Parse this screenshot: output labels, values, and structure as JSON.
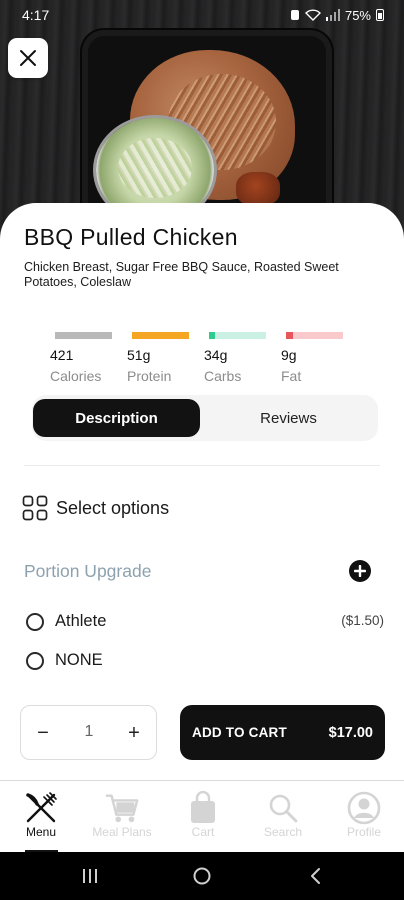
{
  "status_bar": {
    "time": "4:17",
    "battery": "75%"
  },
  "product": {
    "title": "BBQ Pulled Chicken",
    "ingredients": "Chicken Breast, Sugar Free BBQ Sauce, Roasted Sweet Potatoes, Coleslaw"
  },
  "macros": [
    {
      "value": "421",
      "label": "Calories",
      "color": "#b9b9b9",
      "track": "#b9b9b9",
      "fill_fraction": 1.0
    },
    {
      "value": "51g",
      "label": "Protein",
      "color": "#f5a623",
      "track": "#f5a623",
      "fill_fraction": 1.0
    },
    {
      "value": "34g",
      "label": "Carbs",
      "color": "#2ecc8f",
      "track": "#c9f0e2",
      "fill_fraction": 0.1
    },
    {
      "value": "9g",
      "label": "Fat",
      "color": "#e8565b",
      "track": "#f9c9cb",
      "fill_fraction": 0.12
    }
  ],
  "tabs": {
    "description": "Description",
    "reviews": "Reviews",
    "active": "Description"
  },
  "select_options": {
    "label": "Select options"
  },
  "portion": {
    "title": "Portion Upgrade",
    "options": [
      {
        "label": "Athlete",
        "price": "($1.50)"
      },
      {
        "label": "NONE",
        "price": ""
      }
    ]
  },
  "cart": {
    "minus": "−",
    "quantity": "1",
    "plus": "+",
    "add_label": "ADD TO CART",
    "price": "$17.00"
  },
  "nav": {
    "items": [
      {
        "label": "Menu",
        "icon": "fork-knife-icon",
        "active": true
      },
      {
        "label": "Meal Plans",
        "icon": "cart-icon",
        "active": false
      },
      {
        "label": "Cart",
        "icon": "bag-icon",
        "active": false
      },
      {
        "label": "Search",
        "icon": "search-icon",
        "active": false
      },
      {
        "label": "Profile",
        "icon": "profile-icon",
        "active": false
      }
    ]
  },
  "colors": {
    "accent": "#111111",
    "muted_title": "#8da2ae"
  }
}
